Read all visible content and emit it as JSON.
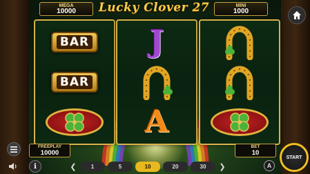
{
  "header": {
    "title": "Lucky Clover 27",
    "mega": {
      "label": "MEGA",
      "value": "10000"
    },
    "mini": {
      "label": "MINI",
      "value": "1000"
    }
  },
  "reels": [
    [
      "bar",
      "bar",
      "clover"
    ],
    [
      "letter-j",
      "horseshoe",
      "letter-a"
    ],
    [
      "horseshoe",
      "horseshoe",
      "clover"
    ]
  ],
  "symbols": {
    "bar_label": "BAR",
    "j_label": "J",
    "a_label": "A"
  },
  "footer": {
    "freeplay": {
      "label": "FREEPLAY",
      "value": "10000"
    },
    "bet": {
      "label": "BET",
      "value": "10"
    },
    "start_label": "START",
    "autoplay_label": "A",
    "info_label": "i",
    "bet_options": [
      "1",
      "5",
      "10",
      "20",
      "30"
    ],
    "active_bet_index": 2
  },
  "colors": {
    "gold": "#d8b24a",
    "start_ring": "#f0c020",
    "active_bet": "#e7b81f",
    "clover_green": "#4bb33a"
  }
}
